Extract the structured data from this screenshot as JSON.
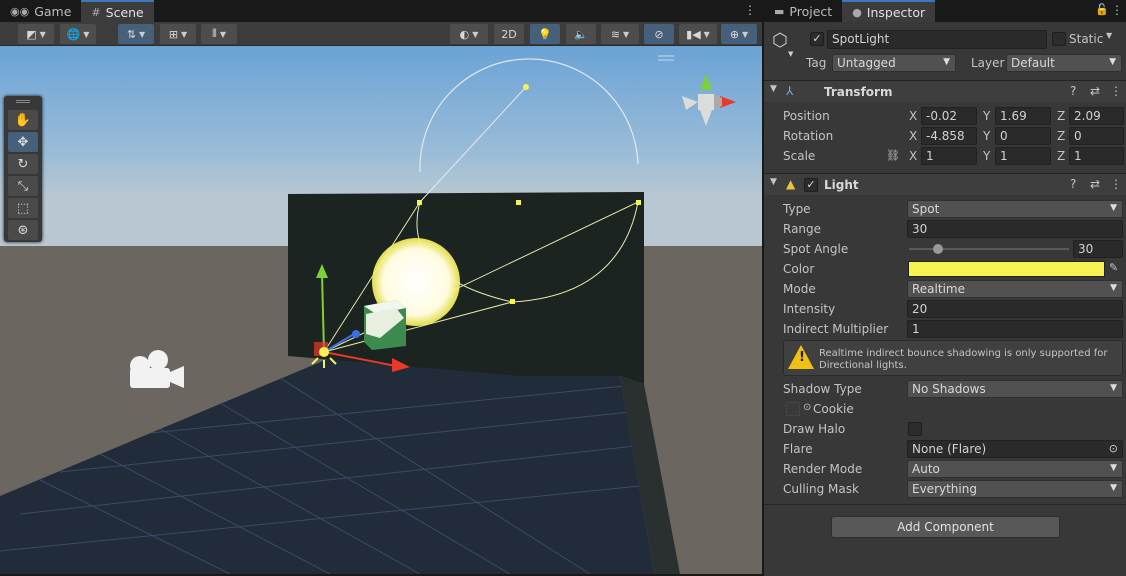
{
  "left_tabs": {
    "game": "Game",
    "scene": "Scene"
  },
  "right_tabs": {
    "project": "Project",
    "inspector": "Inspector"
  },
  "scene_toolbar": {
    "mode_2d": "2D"
  },
  "object": {
    "name": "SpotLight",
    "active": true,
    "static_label": "Static",
    "tag_label": "Tag",
    "tag_value": "Untagged",
    "layer_label": "Layer",
    "layer_value": "Default"
  },
  "transform": {
    "title": "Transform",
    "position_label": "Position",
    "rotation_label": "Rotation",
    "scale_label": "Scale",
    "axis_x": "X",
    "axis_y": "Y",
    "axis_z": "Z",
    "position": {
      "x": "-0.02",
      "y": "1.69",
      "z": "2.09"
    },
    "rotation": {
      "x": "-4.858",
      "y": "0",
      "z": "0"
    },
    "scale": {
      "x": "1",
      "y": "1",
      "z": "1"
    }
  },
  "light": {
    "title": "Light",
    "enabled": true,
    "type_label": "Type",
    "type_value": "Spot",
    "range_label": "Range",
    "range_value": "30",
    "spot_angle_label": "Spot Angle",
    "spot_angle_value": "30",
    "spot_angle_fraction": 0.18,
    "color_label": "Color",
    "color_hex": "#f7f251",
    "mode_label": "Mode",
    "mode_value": "Realtime",
    "intensity_label": "Intensity",
    "intensity_value": "20",
    "indirect_label": "Indirect Multiplier",
    "indirect_value": "1",
    "warning": "Realtime indirect bounce shadowing is only supported for Directional lights.",
    "shadow_type_label": "Shadow Type",
    "shadow_type_value": "No Shadows",
    "cookie_label": "Cookie",
    "draw_halo_label": "Draw Halo",
    "flare_label": "Flare",
    "flare_value": "None (Flare)",
    "render_mode_label": "Render Mode",
    "render_mode_value": "Auto",
    "culling_mask_label": "Culling Mask",
    "culling_mask_value": "Everything"
  },
  "add_component": "Add Component",
  "colors": {
    "accent": "#3a79bb",
    "panel": "#383838",
    "light_color": "#f7f251"
  }
}
